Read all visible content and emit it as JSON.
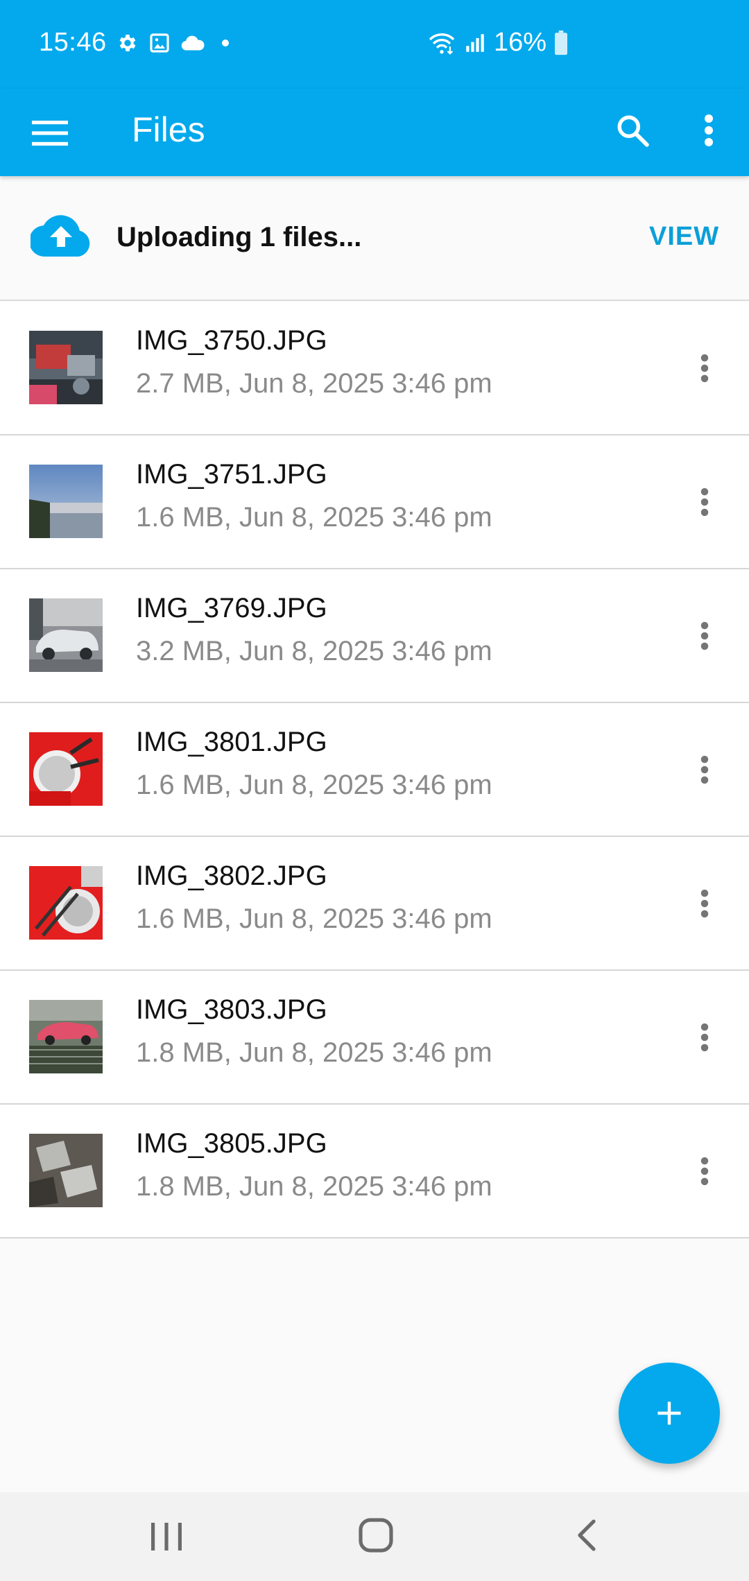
{
  "status_bar": {
    "time": "15:46",
    "battery": "16%",
    "icons": [
      "gear-icon",
      "gallery-icon",
      "cloud-icon",
      "dot-icon",
      "wifi-icon",
      "signal-icon",
      "battery-icon"
    ]
  },
  "app_bar": {
    "title": "Files",
    "icons": [
      "menu-icon",
      "search-icon",
      "more-vert-icon"
    ]
  },
  "upload": {
    "text": "Uploading 1 files...",
    "action": "VIEW",
    "icon": "cloud-upload-icon"
  },
  "files": [
    {
      "name": "IMG_3750.JPG",
      "meta": "2.7 MB, Jun 8, 2025 3:46 pm"
    },
    {
      "name": "IMG_3751.JPG",
      "meta": "1.6 MB, Jun 8, 2025 3:46 pm"
    },
    {
      "name": "IMG_3769.JPG",
      "meta": "3.2 MB, Jun 8, 2025 3:46 pm"
    },
    {
      "name": "IMG_3801.JPG",
      "meta": "1.6 MB, Jun 8, 2025 3:46 pm"
    },
    {
      "name": "IMG_3802.JPG",
      "meta": "1.6 MB, Jun 8, 2025 3:46 pm"
    },
    {
      "name": "IMG_3803.JPG",
      "meta": "1.8 MB, Jun 8, 2025 3:46 pm"
    },
    {
      "name": "IMG_3805.JPG",
      "meta": "1.8 MB, Jun 8, 2025 3:46 pm"
    }
  ],
  "fab": {
    "icon": "add-icon"
  },
  "colors": {
    "primary": "#03a9ec",
    "accent_text": "#0b9fd8",
    "secondary_text": "#8a8a8a"
  }
}
